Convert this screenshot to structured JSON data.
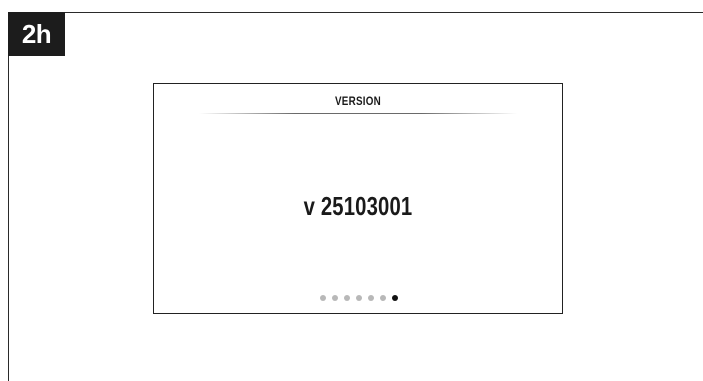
{
  "badge": {
    "label": "2h"
  },
  "screen": {
    "title": "VERSION",
    "value": "v 25103001",
    "pager": {
      "total": 7,
      "active_index": 6
    }
  },
  "colors": {
    "badge_bg": "#1c1c1c",
    "dot_inactive": "#b8b8b8",
    "dot_active": "#111111"
  }
}
